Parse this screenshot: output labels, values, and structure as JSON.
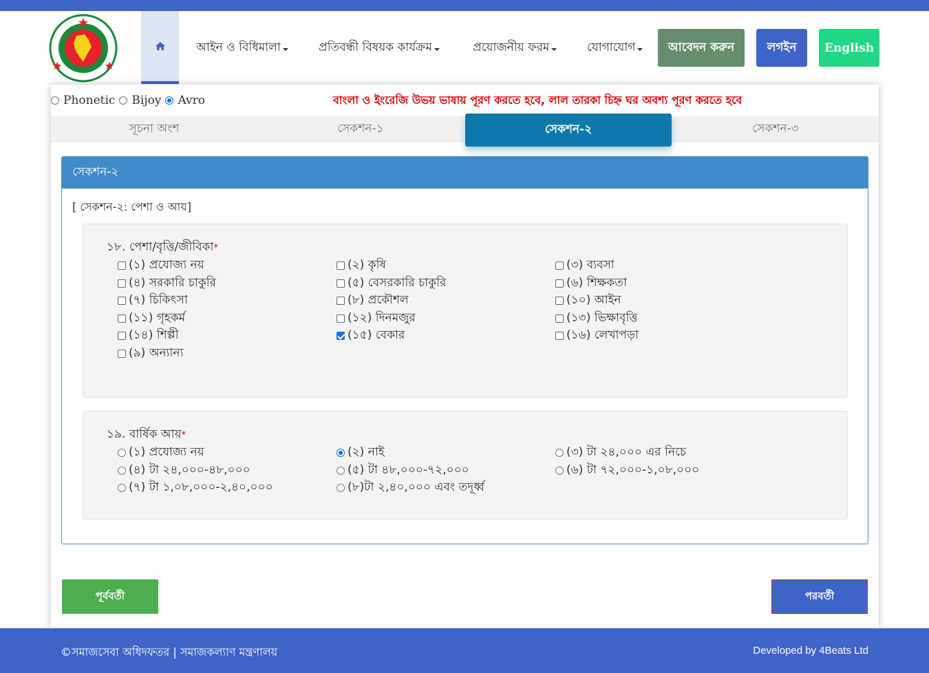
{
  "header": {
    "home_icon": "home-icon",
    "nav": [
      {
        "label": "আইন ও বিধিমালা"
      },
      {
        "label": "প্রতিবন্ধী বিষয়ক কার্যক্রম"
      },
      {
        "label": "প্রয়োজনীয় ফরম"
      },
      {
        "label": "যোগাযোগ"
      }
    ],
    "apply_label": "আবেদন করুন",
    "login_label": "লগইন",
    "english_label": "English",
    "colors": {
      "apply": "#648e6c",
      "login": "#3f63c8",
      "english": "#21d884",
      "brand": "#3f63c8"
    }
  },
  "keyboard": {
    "options": [
      "Phonetic",
      "Bijoy",
      "Avro"
    ],
    "selected": "Avro"
  },
  "warning": "বাংলা ও ইংরেজি উভয় ভাষায় পূরণ করতে হবে, লাল তারকা চিহ্ন ঘর অবশ্য পূরণ করতে হবে",
  "tabs": [
    {
      "label": "সূচনা অংশ"
    },
    {
      "label": "সেকশন-১"
    },
    {
      "label": "সেকশন-২"
    },
    {
      "label": "সেকশন-৩"
    }
  ],
  "active_tab": "সেকশন-২",
  "panel": {
    "heading": "সেকশন-২",
    "subtitle": "[ সেকশন-২: পেশা ও আয়]"
  },
  "q18": {
    "title": "১৮. পেশা/বৃত্তি/জীবিকা",
    "required_mark": "*",
    "options": [
      {
        "label": "(১) প্রযোজ্য নয়",
        "checked": false
      },
      {
        "label": "(২) কৃষি",
        "checked": false
      },
      {
        "label": "(৩) ব্যবসা",
        "checked": false
      },
      {
        "label": "(৪) সরকারি চাকুরি",
        "checked": false
      },
      {
        "label": "(৫) বেসরকারি চাকুরি",
        "checked": false
      },
      {
        "label": "(৬) শিক্ষকতা",
        "checked": false
      },
      {
        "label": "(৭) চিকিৎসা",
        "checked": false
      },
      {
        "label": "(৮) প্রকৌশল",
        "checked": false
      },
      {
        "label": "(১০) আইন",
        "checked": false
      },
      {
        "label": "(১১) গৃহকর্ম",
        "checked": false
      },
      {
        "label": "(১২) দিনমজুর",
        "checked": false
      },
      {
        "label": "(১৩) ভিক্ষাবৃত্তি",
        "checked": false
      },
      {
        "label": "(১৪) শিল্পী",
        "checked": false
      },
      {
        "label": "(১৫) বেকার",
        "checked": true
      },
      {
        "label": "(১৬) লেখাপড়া",
        "checked": false
      },
      {
        "label": "(৯) অন্যান্য",
        "checked": false
      }
    ]
  },
  "q19": {
    "title": "১৯. বার্ষিক আয়",
    "required_mark": "*",
    "options": [
      {
        "label": "(১) প্রযোজ্য নয়",
        "selected": false
      },
      {
        "label": "(২) নাই",
        "selected": true
      },
      {
        "label": "(৩) টা ২৪,০০০ এর নিচে",
        "selected": false
      },
      {
        "label": "(৪) টা ২৪,০০০-৪৮,০০০",
        "selected": false
      },
      {
        "label": "(৫) টা ৪৮,০০০-৭২,০০০",
        "selected": false
      },
      {
        "label": "(৬) টা ৭২,০০০-১,০৮,০০০",
        "selected": false
      },
      {
        "label": "(৭) টা ১,০৮,০০০-২,৪০,০০০",
        "selected": false
      },
      {
        "label": "(৮)টা ২,৪০,০০০ এবং তদূর্ধ্ব",
        "selected": false
      }
    ]
  },
  "buttons": {
    "prev_label": "পূর্ববর্তী",
    "next_label": "পরবর্তী",
    "colors": {
      "prev": "#4cae4c",
      "next": "#3f63c8"
    }
  },
  "footer": {
    "left": "©সমাজসেবা অধিদফতর | সমাজকল্যাণ মন্ত্রণালয়",
    "right": "Developed by 4Beats Ltd"
  }
}
